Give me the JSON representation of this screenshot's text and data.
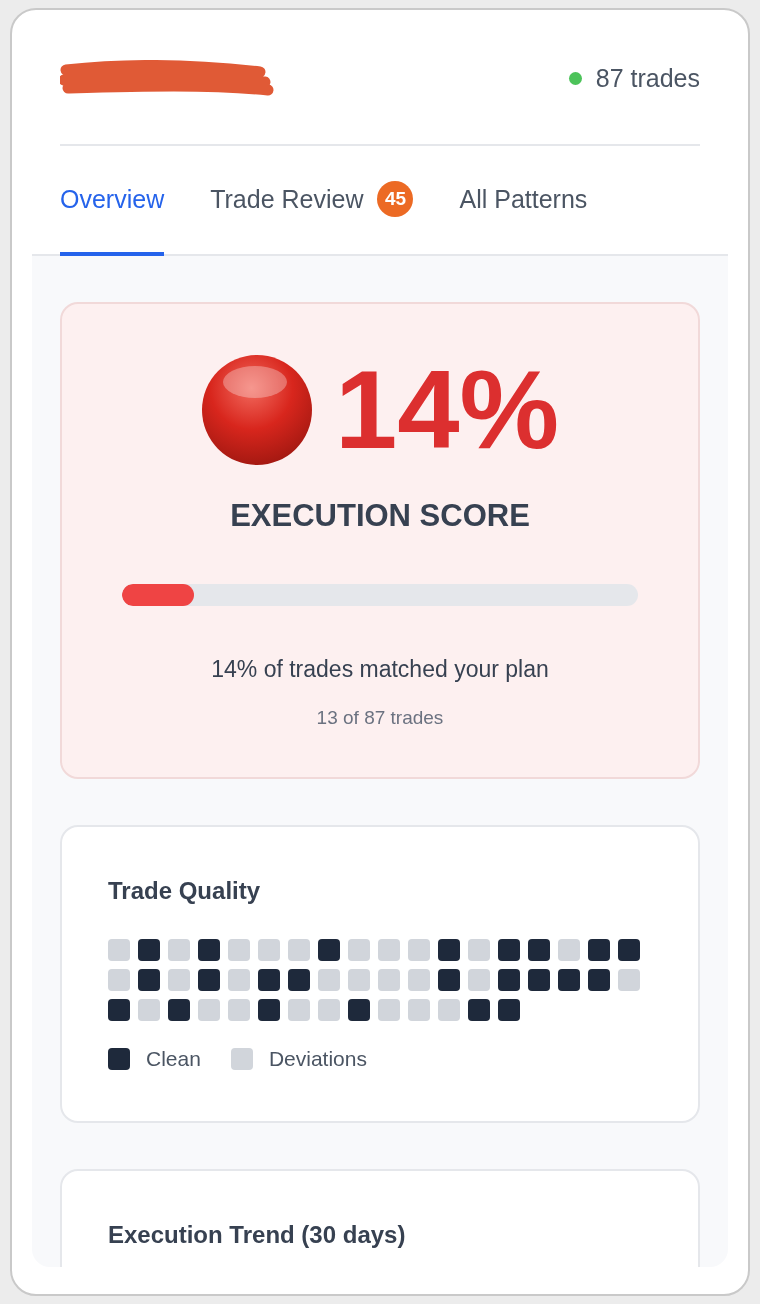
{
  "header": {
    "status": {
      "color": "#4cc35a",
      "label": "87 trades"
    }
  },
  "tabs": [
    {
      "label": "Overview",
      "selected": true
    },
    {
      "label": "Trade Review",
      "selected": false,
      "badge": "45"
    },
    {
      "label": "All Patterns",
      "selected": false
    }
  ],
  "score_card": {
    "value": "14%",
    "title": "EXECUTION SCORE",
    "level": 0.14,
    "summary": "14% of trades matched your plan",
    "detail": "13 of 87 trades"
  },
  "quality_card": {
    "title": "Trade Quality",
    "cells": [
      {
        "clean": false
      },
      {
        "clean": true
      },
      {
        "clean": false
      },
      {
        "clean": true
      },
      {
        "clean": false
      },
      {
        "clean": false
      },
      {
        "clean": false
      },
      {
        "clean": true
      },
      {
        "clean": false
      },
      {
        "clean": false
      },
      {
        "clean": false
      },
      {
        "clean": true
      },
      {
        "clean": false
      },
      {
        "clean": true
      },
      {
        "clean": true
      },
      {
        "clean": false
      },
      {
        "clean": true
      },
      {
        "clean": true
      },
      {
        "clean": false
      },
      {
        "clean": true
      },
      {
        "clean": false
      },
      {
        "clean": true
      },
      {
        "clean": false
      },
      {
        "clean": true
      },
      {
        "clean": true
      },
      {
        "clean": false
      },
      {
        "clean": false
      },
      {
        "clean": false
      },
      {
        "clean": false
      },
      {
        "clean": true
      },
      {
        "clean": false
      },
      {
        "clean": true
      },
      {
        "clean": true
      },
      {
        "clean": true
      },
      {
        "clean": true
      },
      {
        "clean": false
      },
      {
        "clean": true
      },
      {
        "clean": false
      },
      {
        "clean": true
      },
      {
        "clean": false
      },
      {
        "clean": false
      },
      {
        "clean": true
      },
      {
        "clean": false
      },
      {
        "clean": false
      },
      {
        "clean": true
      },
      {
        "clean": false
      },
      {
        "clean": false
      },
      {
        "clean": false
      },
      {
        "clean": true
      },
      {
        "clean": true
      }
    ],
    "legend": [
      {
        "label": "Clean",
        "clean": true
      },
      {
        "label": "Deviations",
        "clean": false
      }
    ]
  },
  "trend_card": {
    "title": "Execution Trend (30 days)"
  }
}
